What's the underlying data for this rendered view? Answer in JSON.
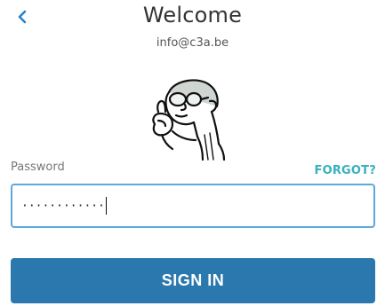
{
  "header": {
    "back_icon": "chevron-left-icon",
    "title": "Welcome",
    "email": "info@c3a.be"
  },
  "avatar": {
    "icon": "cartoon-old-man-avatar"
  },
  "form": {
    "password_label": "Password",
    "forgot_label": "FORGOT?",
    "password_masked": "············",
    "submit_label": "SIGN IN"
  },
  "colors": {
    "accent": "#36b2bd",
    "primary_button": "#2a78ad",
    "field_border": "#5ea9dc",
    "back_icon": "#2a82c9"
  }
}
